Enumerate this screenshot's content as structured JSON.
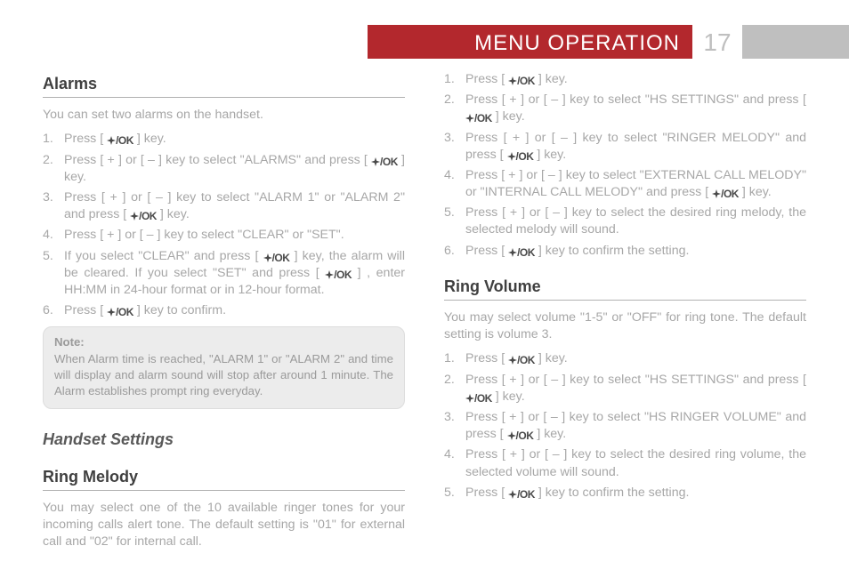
{
  "header": {
    "title": "MENU OPERATION",
    "page": "17"
  },
  "alarms": {
    "heading": "Alarms",
    "intro": "You can set two alarms on the handset.",
    "steps": [
      "Press [ @OK ] key.",
      "Press [ + ] or [ – ] key to select \"ALARMS\" and press [ @OK ] key.",
      "Press [ + ] or [ – ] key to select \"ALARM 1\" or \"ALARM 2\" and press [ @OK ] key.",
      "Press [ + ] or [ – ] key to select \"CLEAR\" or \"SET\".",
      "If you select \"CLEAR\" and press [ @OK ] key, the alarm will be cleared. If you select \"SET\" and press [ @OK ] , enter HH:MM in 24-hour format or in 12-hour format.",
      "Press [ @OK ] key to confirm."
    ],
    "note_label": "Note:",
    "note_body": "When Alarm time is reached, \"ALARM 1\" or \"ALARM 2\" and time will display and alarm sound will stop after around 1 minute. The Alarm establishes prompt ring everyday."
  },
  "handset_settings_heading": "Handset Settings",
  "ring_melody": {
    "heading": "Ring Melody",
    "intro": "You may select one of the 10 available ringer tones for your incoming calls alert tone. The default setting is \"01\" for external call and \"02\" for internal call.",
    "steps": [
      "Press [ @OK ] key.",
      "Press [ + ] or [ – ] key to select \"HS SETTINGS\" and press [ @OK ] key.",
      "Press [ + ] or [ – ] key to select \"RINGER MELODY\" and press [ @OK ] key.",
      "Press [ + ] or [ – ] key to select \"EXTERNAL CALL MELODY\" or \"INTERNAL CALL MELODY\" and press [ @OK ] key.",
      "Press [ + ] or [ – ] key to select the desired ring melody, the selected melody will sound.",
      "Press [ @OK ] key to confirm the setting."
    ]
  },
  "ring_volume": {
    "heading": "Ring Volume",
    "intro": "You may select volume \"1-5\" or \"OFF\" for ring tone. The default setting is volume 3.",
    "steps": [
      "Press [ @OK ] key.",
      "Press [ + ] or [ – ] key to select \"HS SETTINGS\" and press [ @OK ] key.",
      "Press [ + ] or [ – ] key to select \"HS RINGER VOLUME\" and press [ @OK ] key.",
      "Press [ + ] or [ – ] key to select the desired ring volume, the selected volume will sound.",
      "Press [ @OK ] key to confirm the setting."
    ]
  }
}
